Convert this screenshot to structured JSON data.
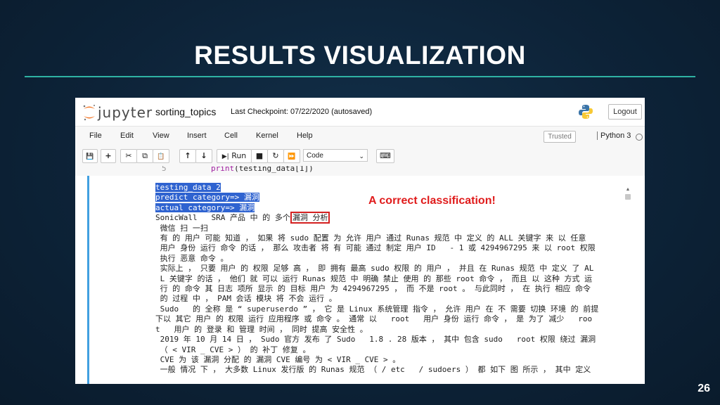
{
  "slide": {
    "title": "RESULTS VISUALIZATION",
    "page_number": "26",
    "annotation": "A correct classification!"
  },
  "jupyter": {
    "logo_text": "jupyter",
    "notebook_name": "sorting_topics",
    "checkpoint": "Last Checkpoint: 07/22/2020   (autosaved)",
    "logout_label": "Logout",
    "menu": [
      "File",
      "Edit",
      "View",
      "Insert",
      "Cell",
      "Kernel",
      "Help"
    ],
    "trusted_label": "Trusted",
    "kernel_label": "Python 3",
    "toolbar": {
      "save_icon": "💾",
      "add_icon": "+",
      "cut_icon": "✂",
      "copy_icon": "⧉",
      "paste_icon": "📋",
      "up_icon": "↑",
      "down_icon": "↓",
      "run_label": "Run",
      "stop_icon": "■",
      "restart_icon": "↻",
      "fastforward_icon": "⏩",
      "cell_type": "Code",
      "keyboard_icon": "⌨"
    },
    "code_cell": {
      "line_number": "5",
      "code_keyword": "print",
      "code_rest": "(testing_data[1])"
    },
    "output": {
      "line1": "testing_data 2",
      "line2": "predict category=> 漏洞",
      "line3": "actual category=> 漏洞",
      "line4_pre": "SonicWall   SRA 产品 中 的 多个",
      "line4_box": "漏洞 分析",
      "body": " 微信 扫 一扫\n 有 的 用户 可能 知道 ， 如果 将 sudo 配置 为 允许 用户 通过 Runas 规范 中 定义 的 ALL 关键字 来 以 任意\n 用户 身份 运行 命令 的话 ， 那么 攻击者 将 有 可能 通过 制定 用户 ID   - 1 或 4294967295 来 以 root 权限\n 执行 恶意 命令 。\n 实际上 ， 只要 用户 的 权限 足够 高 ， 即 拥有 最高 sudo 权限 的 用户 ， 并且 在 Runas 规范 中 定义 了 AL\n L 关键字 的话 ， 他们 就 可以 运行 Runas 规范 中 明确 禁止 使用 的 那些 root 命令 ， 而且 以 这种 方式 运\n 行 的 命令 其 日志 项所 显示 的 目标 用户 为 4294967295 ， 而 不是 root 。 与此同时 ， 在 执行 相应 命令\n 的 过程 中 ， PAM 会话 模块 将 不会 运行 。\n Sudo   的 全称 是 “ superuserdo ” ， 它 是 Linux 系统管理 指令 ， 允许 用户 在 不 需要 切换 环境 的 前提\n下以 其它 用户 的 权限 运行 应用程序 或 命令 。 通常 以   root   用户 身份 运行 命令 ， 是 为了 减少   roo\nt   用户 的 登录 和 管理 时间 ， 同时 提高 安全性 。\n 2019 年 10 月 14 日 ， Sudo 官方 发布 了 Sudo   1.8 . 28 版本 ， 其中 包含 sudo   root 权限 绕过 漏洞\n （ < VIR _ CVE > ） 的 补丁 修复 。\n CVE 为 该 漏洞 分配 的 漏洞 CVE 编号 为 < VIR _ CVE > 。\n 一般 情况 下 ， 大多数 Linux 发行版 的 Runas 规范 （ / etc   / sudoers ） 都 如下 图 所示 ， 其中 定义"
    }
  },
  "colors": {
    "background": "#0d2338",
    "rule": "#2fb2a3",
    "selection": "#2f63d0",
    "annotation": "#e01b1b",
    "cell_border": "#41a0e0"
  }
}
